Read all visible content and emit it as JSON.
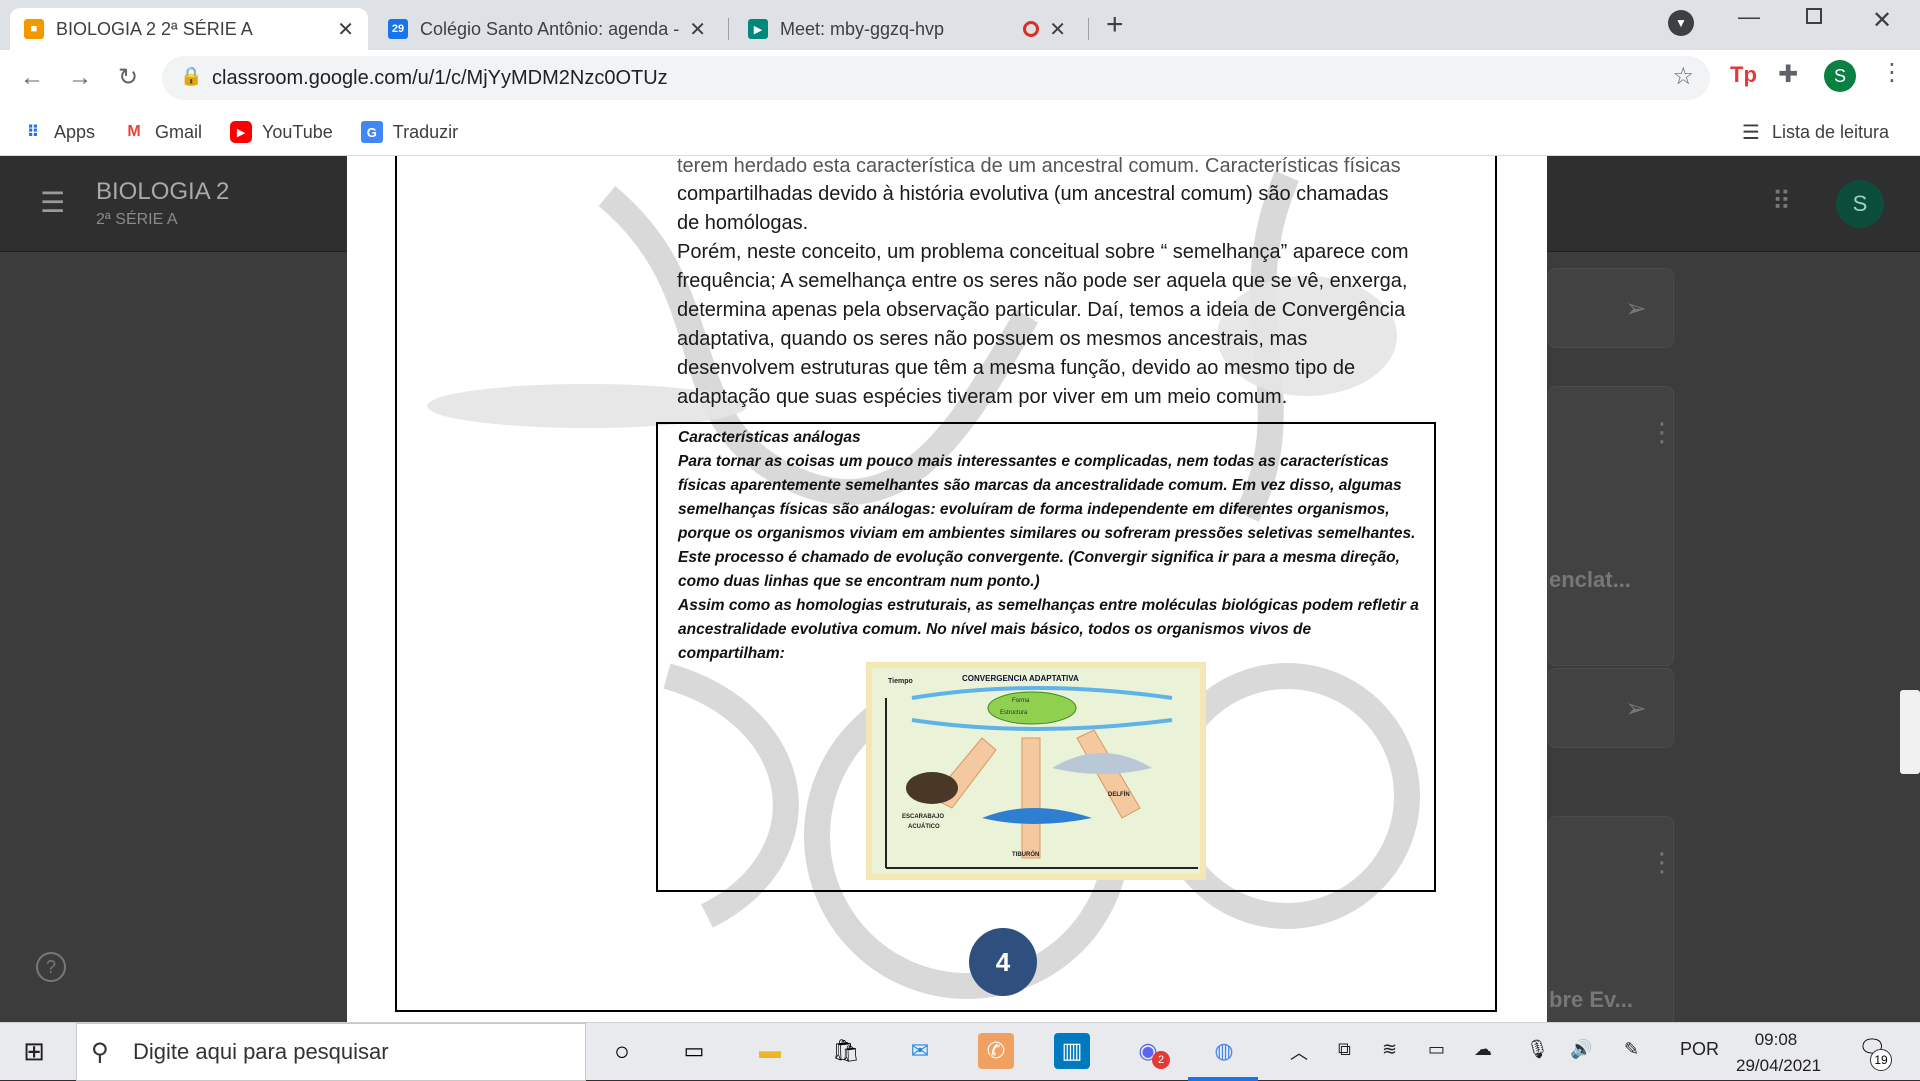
{
  "browser": {
    "tabs": [
      {
        "title": "BIOLOGIA 2 2ª SÉRIE A",
        "active": true
      },
      {
        "title": "Colégio Santo Antônio: agenda -",
        "badge": "29",
        "active": false
      },
      {
        "title": "Meet: mby-ggzq-hvp",
        "active": false
      }
    ],
    "url": "classroom.google.com/u/1/c/MjYyMDM2Nzc0OTUz",
    "bookmarks": [
      {
        "label": "Apps",
        "icon": "apps-grid-icon"
      },
      {
        "label": "Gmail",
        "icon": "gmail-icon"
      },
      {
        "label": "YouTube",
        "icon": "youtube-icon"
      },
      {
        "label": "Traduzir",
        "icon": "translate-icon"
      }
    ],
    "reading_list": "Lista de leitura",
    "profile_initial": "S",
    "colors": {
      "tab_active": "#ffffff",
      "tabbar": "#dee1e6",
      "profile": "#0b8043"
    }
  },
  "classroom": {
    "title": "BIOLOGIA 2",
    "subtitle": "2ª SÉRIE A",
    "avatar_initial": "S",
    "side_card_1": "enclat...",
    "side_card_2": "bre Ev..."
  },
  "document": {
    "para1_cut": "terem herdado esta característica de um ancestral comum. Características físicas",
    "para1_line2": "compartilhadas devido à história evolutiva (um ancestral comum) são chamadas",
    "para1_line3": "de homólogas.",
    "para2_l1": "Porém, neste conceito, um problema conceitual sobre “ semelhança” aparece com",
    "para2_l2": "frequência; A semelhança entre os seres não pode ser aquela que se vê, enxerga,",
    "para2_l3": "determina apenas pela observação particular. Daí, temos a ideia de Convergência",
    "para2_l4": "adaptativa, quando os seres não possuem os mesmos ancestrais, mas",
    "para2_l5": "desenvolvem estruturas que têm a mesma função, devido ao mesmo tipo de",
    "para2_l6": "adaptação que suas espécies tiveram por viver em um meio comum.",
    "box": {
      "l1": "Características análogas",
      "l2": "Para tornar as coisas um pouco mais interessantes e complicadas, nem todas as características",
      "l3": "físicas aparentemente semelhantes são marcas da ancestralidade comum. Em vez disso, algumas",
      "l4": "semelhanças físicas são análogas: evoluíram de forma independente em diferentes organismos,",
      "l5": "porque os organismos viviam em ambientes similares ou sofreram pressões seletivas semelhantes.",
      "l6": "Este processo é chamado de evolução convergente. (Convergir significa ir para a mesma direção,",
      "l7": "como duas linhas que se encontram num ponto.)",
      "l8": "Assim como as homologias estruturais, as semelhanças entre moléculas biológicas podem refletir a",
      "l9": "ancestralidade evolutiva comum. No nível mais básico, todos os organismos vivos de",
      "l10": "compartilham:"
    },
    "figure": {
      "title": "CONVERGENCIA ADAPTATIVA",
      "axis": "Tiempo",
      "center1": "Forma",
      "center2": "Estructura",
      "label_beetle1": "ESCARABAJO",
      "label_beetle2": "ACUÁTICO",
      "label_shark": "TIBURÓN",
      "label_dolphin": "DELFÍN"
    },
    "page_number": "4"
  },
  "taskbar": {
    "search_placeholder": "Digite aqui para pesquisar",
    "language": "POR",
    "time": "09:08",
    "date": "29/04/2021",
    "notifications": "19",
    "discord_badge": "2"
  }
}
